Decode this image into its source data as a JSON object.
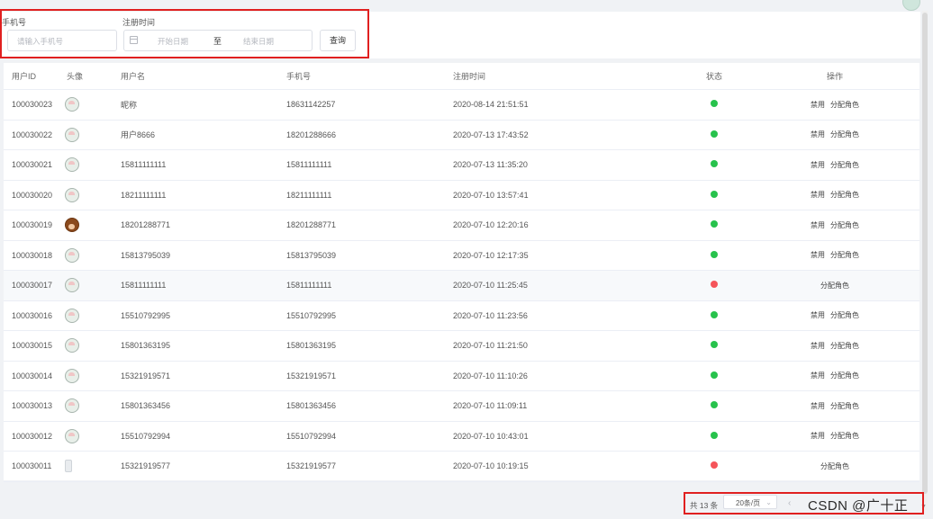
{
  "search": {
    "phone_label": "手机号",
    "phone_placeholder": "请输入手机号",
    "regtime_label": "注册时间",
    "start_placeholder": "开始日期",
    "range_separator": "至",
    "end_placeholder": "结束日期",
    "query_button": "查询"
  },
  "table": {
    "headers": [
      "用户ID",
      "头像",
      "用户名",
      "手机号",
      "注册时间",
      "状态",
      "操作"
    ],
    "rows": [
      {
        "id": "100030023",
        "avatar": "default",
        "name": "昵称",
        "phone": "18631142257",
        "time": "2020-08-14 21:51:51",
        "status": "green",
        "ops": [
          "禁用",
          "分配角色"
        ]
      },
      {
        "id": "100030022",
        "avatar": "default",
        "name": "用户8666",
        "phone": "18201288666",
        "time": "2020-07-13 17:43:52",
        "status": "green",
        "ops": [
          "禁用",
          "分配角色"
        ]
      },
      {
        "id": "100030021",
        "avatar": "default",
        "name": "15811111111",
        "phone": "15811111111",
        "time": "2020-07-13 11:35:20",
        "status": "green",
        "ops": [
          "禁用",
          "分配角色"
        ]
      },
      {
        "id": "100030020",
        "avatar": "default",
        "name": "18211111111",
        "phone": "18211111111",
        "time": "2020-07-10 13:57:41",
        "status": "green",
        "ops": [
          "禁用",
          "分配角色"
        ]
      },
      {
        "id": "100030019",
        "avatar": "cartoon",
        "name": "18201288771",
        "phone": "18201288771",
        "time": "2020-07-10 12:20:16",
        "status": "green",
        "ops": [
          "禁用",
          "分配角色"
        ]
      },
      {
        "id": "100030018",
        "avatar": "default",
        "name": "15813795039",
        "phone": "15813795039",
        "time": "2020-07-10 12:17:35",
        "status": "green",
        "ops": [
          "禁用",
          "分配角色"
        ]
      },
      {
        "id": "100030017",
        "avatar": "default",
        "name": "15811111111",
        "phone": "15811111111",
        "time": "2020-07-10 11:25:45",
        "status": "red",
        "ops": [
          "分配角色"
        ]
      },
      {
        "id": "100030016",
        "avatar": "default",
        "name": "15510792995",
        "phone": "15510792995",
        "time": "2020-07-10 11:23:56",
        "status": "green",
        "ops": [
          "禁用",
          "分配角色"
        ]
      },
      {
        "id": "100030015",
        "avatar": "default",
        "name": "15801363195",
        "phone": "15801363195",
        "time": "2020-07-10 11:21:50",
        "status": "green",
        "ops": [
          "禁用",
          "分配角色"
        ]
      },
      {
        "id": "100030014",
        "avatar": "default",
        "name": "15321919571",
        "phone": "15321919571",
        "time": "2020-07-10 11:10:26",
        "status": "green",
        "ops": [
          "禁用",
          "分配角色"
        ]
      },
      {
        "id": "100030013",
        "avatar": "default",
        "name": "15801363456",
        "phone": "15801363456",
        "time": "2020-07-10 11:09:11",
        "status": "green",
        "ops": [
          "禁用",
          "分配角色"
        ]
      },
      {
        "id": "100030012",
        "avatar": "default",
        "name": "15510792994",
        "phone": "15510792994",
        "time": "2020-07-10 10:43:01",
        "status": "green",
        "ops": [
          "禁用",
          "分配角色"
        ]
      },
      {
        "id": "100030011",
        "avatar": "small",
        "name": "15321919577",
        "phone": "15321919577",
        "time": "2020-07-10 10:19:15",
        "status": "red",
        "ops": [
          "分配角色"
        ]
      }
    ]
  },
  "pagination": {
    "total": "共 13 条",
    "page_size": "20条/页",
    "prev_icon": "chevron-left-icon"
  },
  "watermark": "CSDN @广十正",
  "colors": {
    "status_green": "#27c24c",
    "status_red": "#f5545a",
    "highlight_box": "#e02020"
  }
}
